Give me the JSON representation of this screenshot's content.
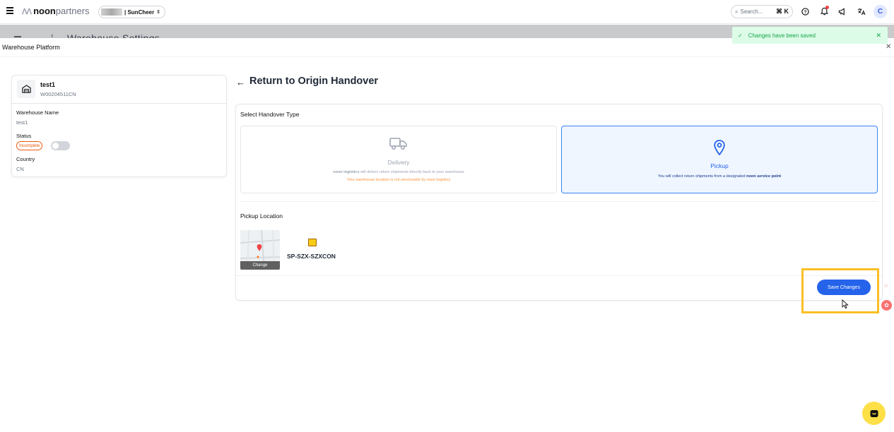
{
  "topbar": {
    "logo_brand": "noon",
    "logo_suffix": "partners",
    "store_name": "| SunCheer",
    "search_placeholder": "Search...",
    "search_shortcut": "⌘ K",
    "user_initial": "C"
  },
  "background_page": {
    "title": "Warehouse Settings"
  },
  "toast": {
    "message": "Changes have been saved"
  },
  "modal": {
    "title": "Warehouse Platform"
  },
  "warehouse": {
    "name": "test1",
    "code": "W00204511CN",
    "name_label": "Warehouse Name",
    "name_value": "test1",
    "status_label": "Status",
    "status_badge": "Incomplete",
    "country_label": "Country",
    "country_value": "CN"
  },
  "page_title": "Return to Origin Handover",
  "handover": {
    "section_label": "Select Handover Type",
    "delivery": {
      "title": "Delivery",
      "desc_brand": "noon logistics",
      "desc_text": "will deliver return shipments directly back to your warehouse",
      "warning": "Your warehouse location is not serviceable by noon logistics"
    },
    "pickup": {
      "title": "Pickup",
      "desc_text": "You will collect return shipments from a designated",
      "desc_brand": "noon service point"
    }
  },
  "pickup_location": {
    "section_label": "Pickup Location",
    "change_label": "Change",
    "location_name": "SP-SZX-SZXCON"
  },
  "actions": {
    "save_label": "Save Changes"
  },
  "colors": {
    "accent": "#2563eb",
    "selected_bg": "#eff6ff",
    "toast_bg": "#dcfce7",
    "warning": "#fb923c",
    "highlight": "#fbbf24"
  }
}
